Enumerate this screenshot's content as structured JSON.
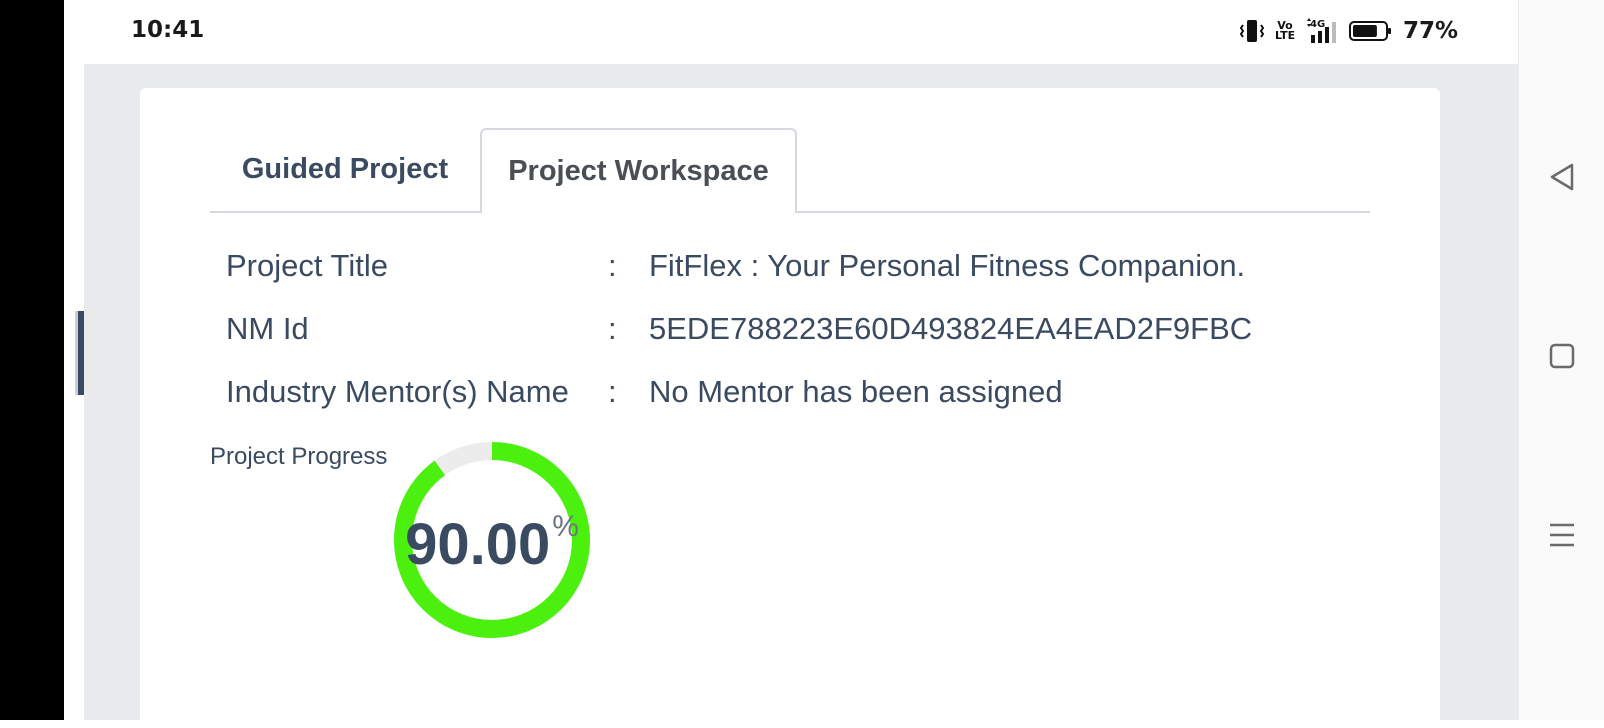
{
  "status_bar": {
    "time": "10:41",
    "volte_line1": "Vo",
    "volte_line2": "LTE",
    "network": "4G",
    "battery_percent": "77%",
    "battery_level": 0.77
  },
  "tabs": [
    {
      "label": "Guided Project",
      "active": false
    },
    {
      "label": "Project Workspace",
      "active": true
    }
  ],
  "project_info": {
    "separator": ":",
    "rows": [
      {
        "label": "Project Title",
        "value": "FitFlex : Your Personal Fitness Companion."
      },
      {
        "label": "NM Id",
        "value": "5EDE788223E60D493824EA4EAD2F9FBC"
      },
      {
        "label": "Industry Mentor(s) Name",
        "value": "No Mentor has been assigned"
      }
    ]
  },
  "progress": {
    "label": "Project Progress",
    "value_text": "90.00",
    "unit": "%",
    "percent": 90,
    "colors": {
      "fill": "#4cf00f",
      "track": "#ececec"
    }
  },
  "icons": [
    "vibrate-icon",
    "volte-icon",
    "signal-icon",
    "battery-icon",
    "back-icon",
    "home-icon",
    "menu-icon"
  ]
}
